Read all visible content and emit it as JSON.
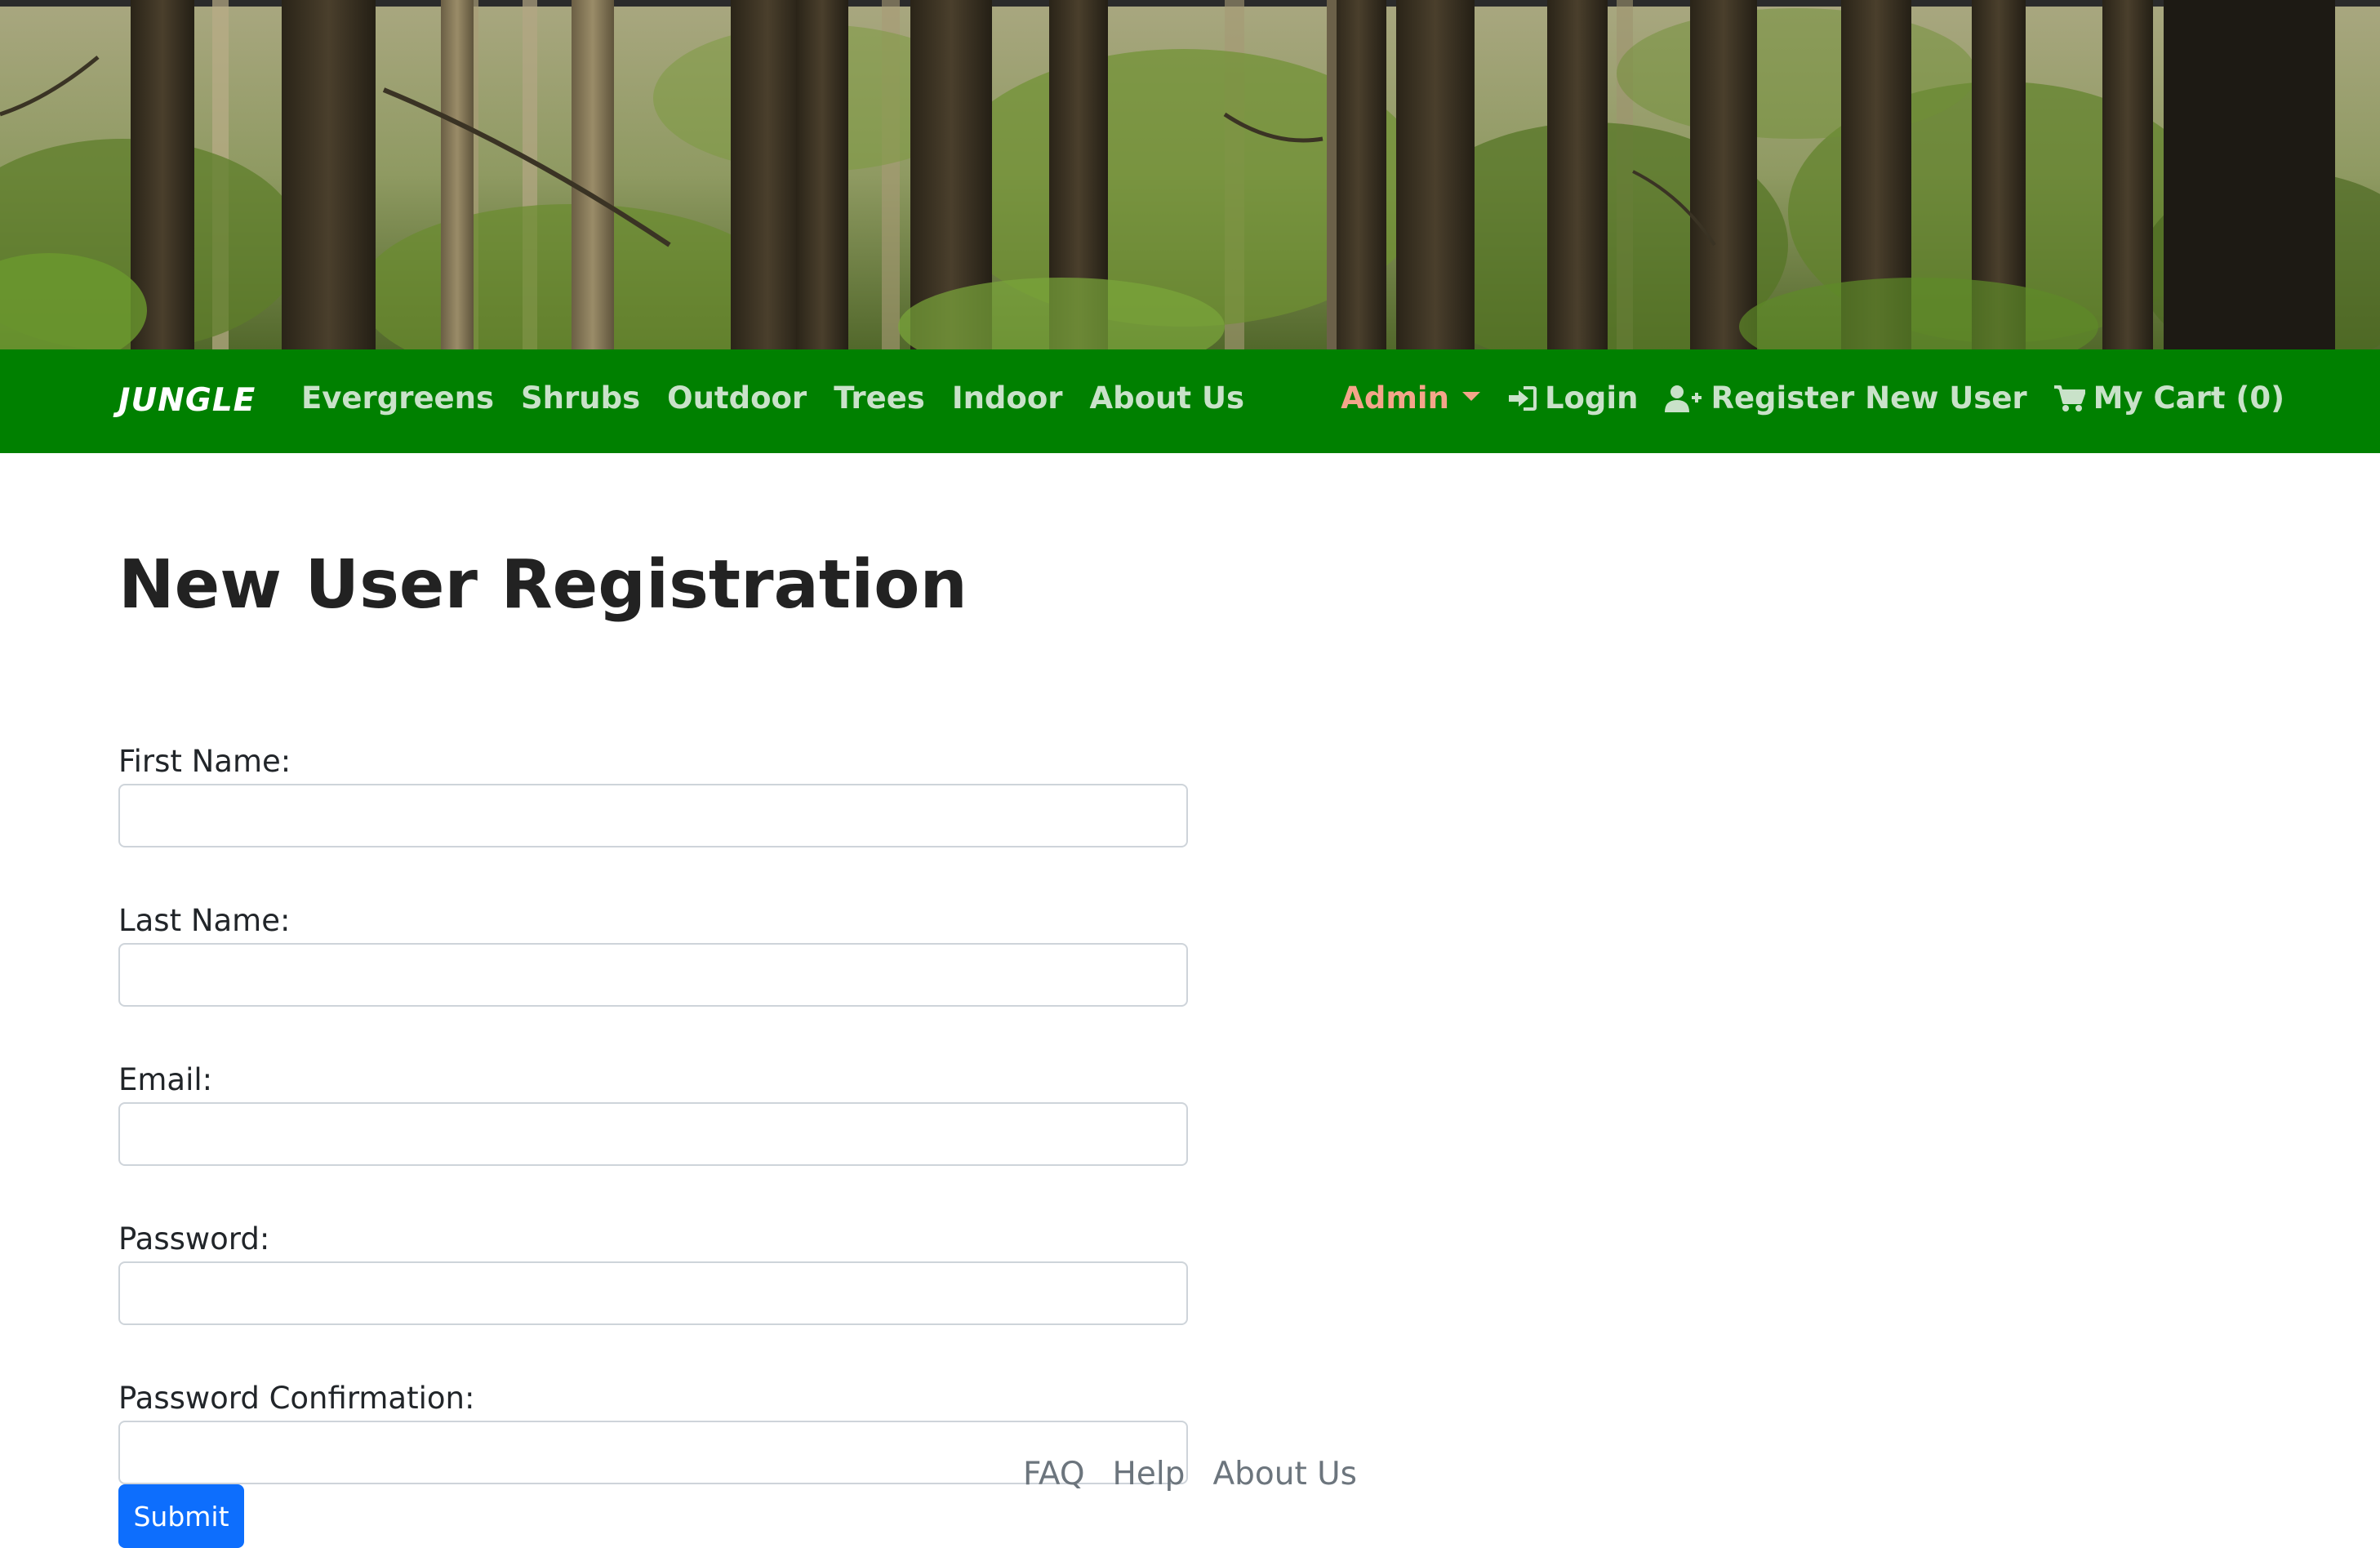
{
  "nav": {
    "brand": "JUNGLE",
    "links": [
      "Evergreens",
      "Shrubs",
      "Outdoor",
      "Trees",
      "Indoor",
      "About Us"
    ],
    "admin": "Admin",
    "login": "Login",
    "register": "Register New User",
    "cart": "My Cart (0)"
  },
  "page": {
    "title": "New User Registration"
  },
  "form": {
    "first_name_label": "First Name:",
    "last_name_label": "Last Name:",
    "email_label": "Email:",
    "password_label": "Password:",
    "password_confirmation_label": "Password Confirmation:",
    "submit_label": "Submit"
  },
  "footer": {
    "links": [
      "FAQ",
      "Help",
      "About Us"
    ]
  },
  "colors": {
    "navbar": "#008000",
    "nav_link": "#c9e2c9",
    "admin": "#f4a58a",
    "submit": "#0d6efd",
    "footer_link": "#6c757d"
  },
  "icons": {
    "login": "sign-in-icon",
    "register": "user-plus-icon",
    "cart": "shopping-cart-icon",
    "admin_caret": "caret-down-icon"
  }
}
